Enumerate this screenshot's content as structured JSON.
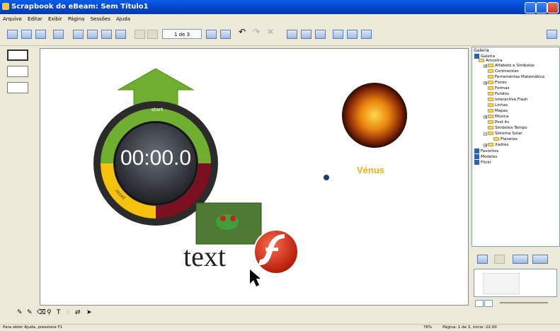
{
  "window": {
    "title": "Scrapbook do eBeam: Sem Título1"
  },
  "menu": [
    "Arquivo",
    "Editar",
    "Exibir",
    "Página",
    "Sessões",
    "Ajuda"
  ],
  "toolbar": {
    "page_indicator": "1 de 3"
  },
  "canvas": {
    "timer": {
      "display": "00:00.0",
      "start_label": "start",
      "reset_label": "reset"
    },
    "planet_label": "Vénus",
    "text_object": "text"
  },
  "gallery": {
    "title": "Galeria",
    "root": "Galeria",
    "amostra": "Amostra",
    "items": [
      "Alfabeto e Símbolos",
      "Continentes",
      "Ferramentas Matemática",
      "Flores",
      "Formas",
      "Fundos",
      "Interactive Flash",
      "Linhas",
      "Mapas",
      "Música",
      "Post its",
      "Símbolos Tempo",
      "Sistema Solar",
      "Planetas",
      "Xadrez"
    ],
    "other": [
      "Favoritos",
      "Modelos",
      "Flickr"
    ]
  },
  "status": {
    "help": "Para obter Ajuda, pressione F1",
    "zoom": "76%",
    "page_info": "Página: 1 de 3, início: 22:00"
  },
  "colors": {
    "title_bar": "#0a5de7",
    "planet_label": "#f2b311",
    "timer_green": "#6fae2f",
    "timer_yellow": "#f4c20d",
    "timer_red": "#7a1020"
  }
}
